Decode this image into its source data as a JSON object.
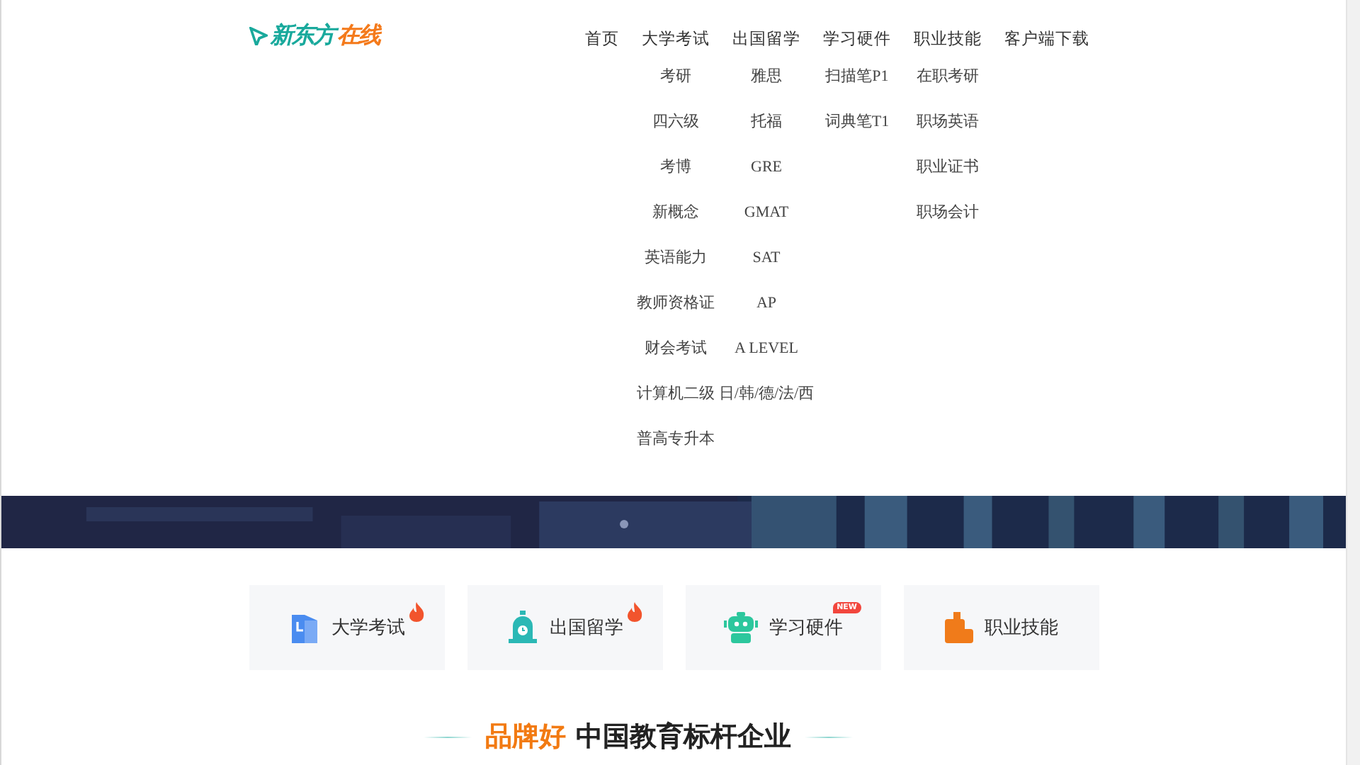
{
  "logo": {
    "brand": "新东方",
    "suffix": "在线"
  },
  "nav": [
    {
      "label": "首页"
    },
    {
      "label": "大学考试",
      "items": [
        "考研",
        "四六级",
        "考博",
        "新概念",
        "英语能力",
        "教师资格证",
        "财会考试",
        "计算机二级",
        "普高专升本"
      ]
    },
    {
      "label": "出国留学",
      "items": [
        "雅思",
        "托福",
        "GRE",
        "GMAT",
        "SAT",
        "AP",
        "A LEVEL",
        "日/韩/德/法/西"
      ]
    },
    {
      "label": "学习硬件",
      "items": [
        "扫描笔P1",
        "词典笔T1"
      ]
    },
    {
      "label": "职业技能",
      "items": [
        "在职考研",
        "职场英语",
        "职业证书",
        "职场会计"
      ]
    },
    {
      "label": "客户端下载"
    }
  ],
  "categories": [
    {
      "label": "大学考试",
      "badge": {
        "kind": "hot"
      }
    },
    {
      "label": "出国留学",
      "badge": {
        "kind": "hot"
      }
    },
    {
      "label": "学习硬件",
      "badge": {
        "kind": "new",
        "text": "NEW"
      }
    },
    {
      "label": "职业技能"
    }
  ],
  "headline": {
    "highlight": "品牌好",
    "text": "中国教育标杆企业"
  }
}
